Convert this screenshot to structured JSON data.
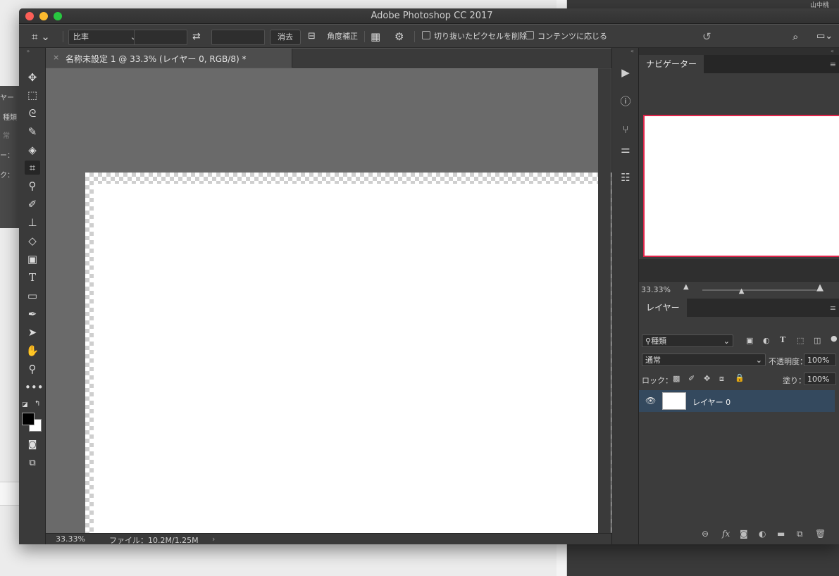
{
  "window": {
    "title": "Adobe Photoshop CC 2017"
  },
  "options_bar": {
    "ratio_label": "比率",
    "width_value": "",
    "height_value": "",
    "clear_button": "消去",
    "straighten_label": "角度補正",
    "delete_cropped_label": "切り抜いたピクセルを削除",
    "content_aware_label": "コンテンツに応じる"
  },
  "document": {
    "tab_title": "名称未設定 1 @ 33.3% (レイヤー 0, RGB/8) *",
    "zoom": "33.33%",
    "file_info": "ファイル：10.2M/1.25M"
  },
  "navigator": {
    "tab_label": "ナビゲーター",
    "zoom": "33.33%",
    "zoom_slider_value": 0.35
  },
  "layers": {
    "tab_label": "レイヤー",
    "filter_kind": "種類",
    "blend_mode": "通常",
    "opacity_label": "不透明度：",
    "opacity_value": "100%",
    "lock_label": "ロック：",
    "fill_label": "塗り：",
    "fill_value": "100%",
    "items": [
      {
        "name": "レイヤー 0",
        "visible": true,
        "selected": true
      }
    ]
  },
  "background_window": {
    "lines": [
      "ヤー",
      "種類",
      "常",
      "ー：",
      "ク："
    ],
    "top_right_text": "山中桃"
  },
  "colors": {
    "selection": "#34495e",
    "navigator_frame": "#e0244a",
    "foreground": "#000000",
    "background": "#ffffff"
  }
}
